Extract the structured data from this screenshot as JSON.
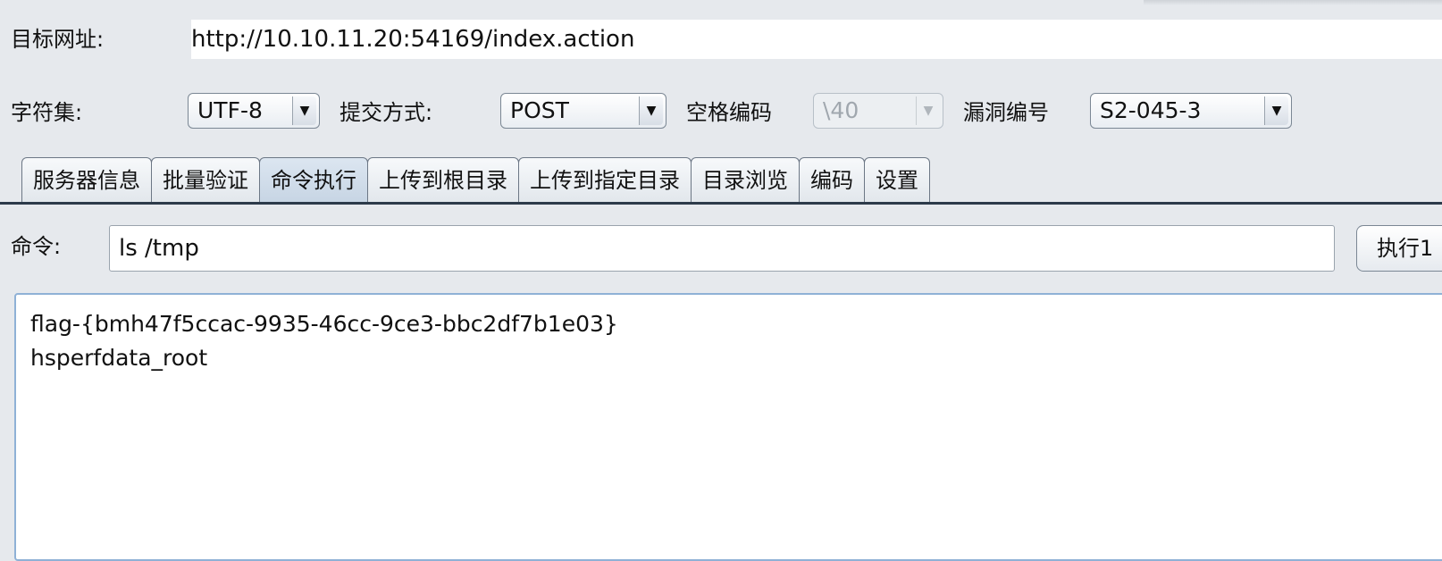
{
  "target": {
    "label": "目标网址:",
    "url": "http://10.10.11.20:54169/index.action"
  },
  "options": {
    "charset_label": "字符集:",
    "charset_value": "UTF-8",
    "method_label": "提交方式:",
    "method_value": "POST",
    "space_label": "空格编码",
    "space_value": "\\40",
    "vuln_label": "漏洞编号",
    "vuln_value": "S2-045-3",
    "dropdown_arrow": "▼"
  },
  "tabs": [
    {
      "label": "服务器信息"
    },
    {
      "label": "批量验证"
    },
    {
      "label": "命令执行",
      "active": true
    },
    {
      "label": "上传到根目录"
    },
    {
      "label": "上传到指定目录"
    },
    {
      "label": "目录浏览"
    },
    {
      "label": "编码"
    },
    {
      "label": "设置"
    }
  ],
  "command": {
    "label": "命令:",
    "value": "ls /tmp",
    "execute_label": "执行1"
  },
  "output": {
    "lines": [
      "flag-{bmh47f5ccac-9935-46cc-9ce3-bbc2df7b1e03}",
      "hsperfdata_root"
    ]
  }
}
